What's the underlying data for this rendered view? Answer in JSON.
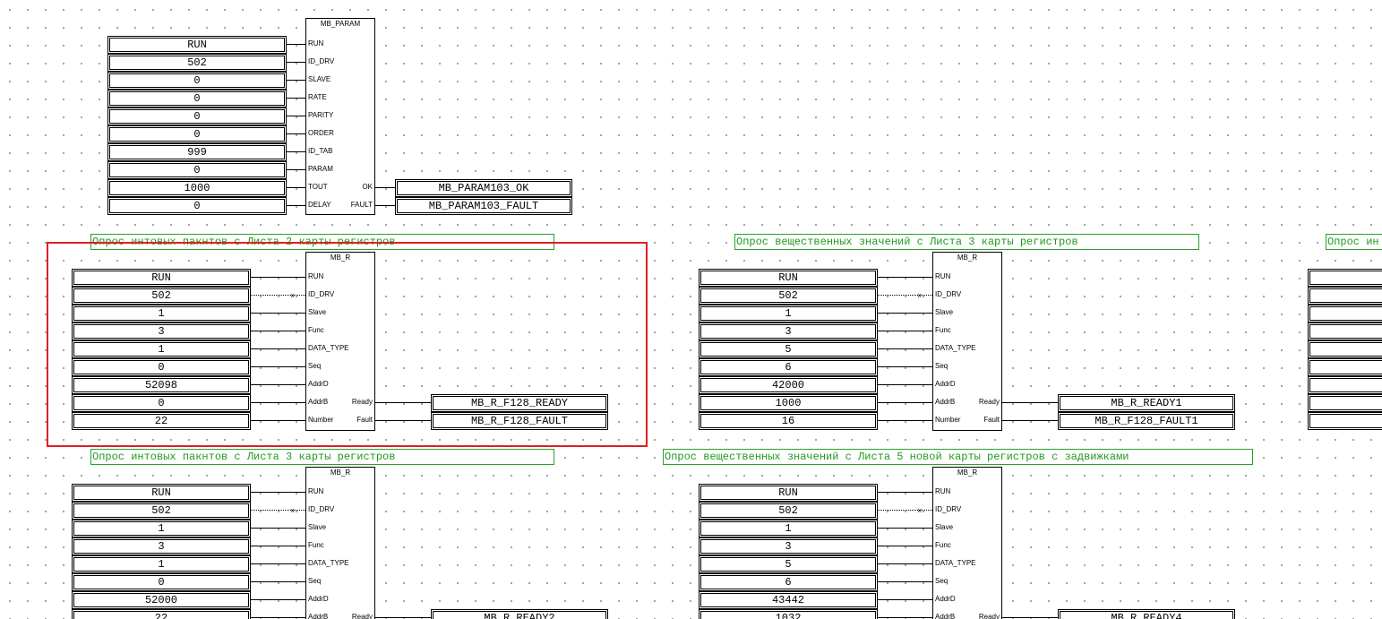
{
  "diagram": {
    "param_block": {
      "title": "MB_PARAM",
      "inputs": [
        "RUN",
        "ID_DRV",
        "SLAVE",
        "RATE",
        "PARITY",
        "ORDER",
        "ID_TAB",
        "PARAM",
        "TOUT",
        "DELAY"
      ],
      "values": [
        "RUN",
        "502",
        "0",
        "0",
        "0",
        "0",
        "999",
        "0",
        "1000",
        "0"
      ],
      "outputs": [
        "OK",
        "FAULT"
      ],
      "out_vars": [
        "MB_PARAM103_OK",
        "MB_PARAM103_FAULT"
      ]
    },
    "comments": [
      "Опрос интовых пакнтов с Листа 2  карты регистров",
      "Опрос вещественных значений с Листа 3  карты регистров",
      "Опрос ин",
      "Опрос интовых пакнтов с Листа 3 карты регистров",
      "Опрос вещественных значений с Листа 5 новой карты регистров с задвижками"
    ],
    "mbr_inputs": [
      "RUN",
      "ID_DRV",
      "Slave",
      "Func",
      "DATA_TYPE",
      "Seq",
      "AddrD",
      "AddrB",
      "Number"
    ],
    "mbr_outputs": [
      "Ready",
      "Fault"
    ],
    "mbr_blocks": [
      {
        "title": "MB_R",
        "values": [
          "RUN",
          "502",
          "1",
          "3",
          "1",
          "0",
          "52098",
          "0",
          "22"
        ],
        "out_vars": [
          "MB_R_F128_READY",
          "MB_R_F128_FAULT"
        ]
      },
      {
        "title": "MB_R",
        "values": [
          "RUN",
          "502",
          "1",
          "3",
          "5",
          "6",
          "42000",
          "1000",
          "16"
        ],
        "out_vars": [
          "MB_R_READY1",
          "MB_R_F128_FAULT1"
        ]
      },
      {
        "title": "MB_R",
        "values": [
          "RUN",
          "502",
          "1",
          "3",
          "1",
          "0",
          "52000",
          "22"
        ],
        "out_vars": [
          "MB_R_READY2"
        ]
      },
      {
        "title": "MB_R",
        "values": [
          "RUN",
          "502",
          "1",
          "3",
          "5",
          "6",
          "43442",
          "1032"
        ],
        "out_vars": [
          "MB_R_READY4"
        ]
      }
    ],
    "colors": {
      "comment": "#1f9a1f",
      "selection": "#e02020",
      "grid_dots": "#8a8a8a"
    }
  }
}
